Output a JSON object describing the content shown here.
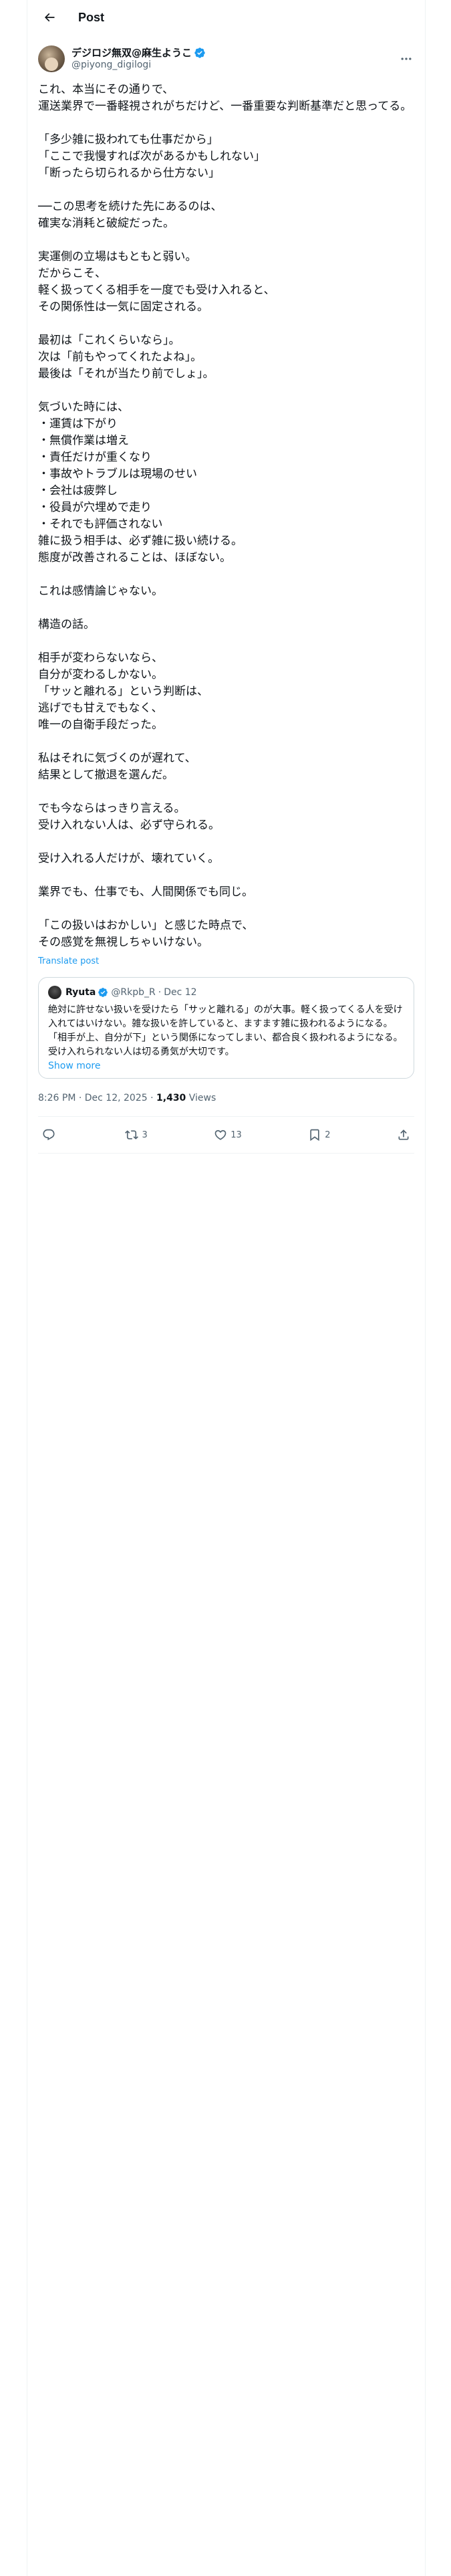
{
  "header": {
    "title": "Post"
  },
  "post": {
    "author": {
      "display_name": "デジロジ無双@麻生ようこ",
      "handle": "@piyong_digilogi"
    },
    "text": "これ、本当にその通りで、\n運送業界で一番軽視されがちだけど、一番重要な判断基準だと思ってる。\n\n「多少雑に扱われても仕事だから」\n「ここで我慢すれば次があるかもしれない」\n「断ったら切られるから仕方ない」\n\n──この思考を続けた先にあるのは、\n確実な消耗と破綻だった。\n\n実運側の立場はもともと弱い。\nだからこそ、\n軽く扱ってくる相手を一度でも受け入れると、\nその関係性は一気に固定される。\n\n最初は「これくらいなら」。\n次は「前もやってくれたよね」。\n最後は「それが当たり前でしょ」。\n\n気づいた時には、\n・運賃は下がり\n・無償作業は増え\n・責任だけが重くなり\n・事故やトラブルは現場のせい\n・会社は疲弊し\n・役員が穴埋めで走り\n・それでも評価されない\n雑に扱う相手は、必ず雑に扱い続ける。\n態度が改善されることは、ほぼない。\n\nこれは感情論じゃない。\n\n構造の話。\n\n相手が変わらないなら、\n自分が変わるしかない。\n「サッと離れる」という判断は、\n逃げでも甘えでもなく、\n唯一の自衛手段だった。\n\n私はそれに気づくのが遅れて、\n結果として撤退を選んだ。\n\nでも今ならはっきり言える。\n受け入れない人は、必ず守られる。\n\n受け入れる人だけが、壊れていく。\n\n業界でも、仕事でも、人間関係でも同じ。\n\n「この扱いはおかしい」と感じた時点で、\nその感覚を無視しちゃいけない。",
    "translate_label": "Translate post",
    "quote": {
      "name": "Ryuta",
      "handle": "@Rkpb_R",
      "separator": "·",
      "date": "Dec 12",
      "text": "絶対に許せない扱いを受けたら「サッと離れる」のが大事。軽く扱ってくる人を受け入れてはいけない。雑な扱いを許していると、ますます雑に扱われるようになる。「相手が上、自分が下」という関係になってしまい、都合良く扱われるようになる。受け入れられない人は切る勇気が大切です。",
      "show_more": "Show more"
    },
    "timestamp": "8:26 PM · Dec 12, 2025",
    "meta_sep": " · ",
    "views_count": "1,430",
    "views_label": " Views",
    "actions": {
      "replies": "",
      "reposts": "3",
      "likes": "13",
      "bookmarks": "2"
    }
  },
  "colors": {
    "accent": "#1d9bf0",
    "verified": "#1d9bf0",
    "muted": "#536471"
  },
  "icons": [
    "back-arrow-icon",
    "verified-badge-icon",
    "more-icon",
    "reply-icon",
    "repost-icon",
    "like-icon",
    "bookmark-icon",
    "share-icon"
  ]
}
